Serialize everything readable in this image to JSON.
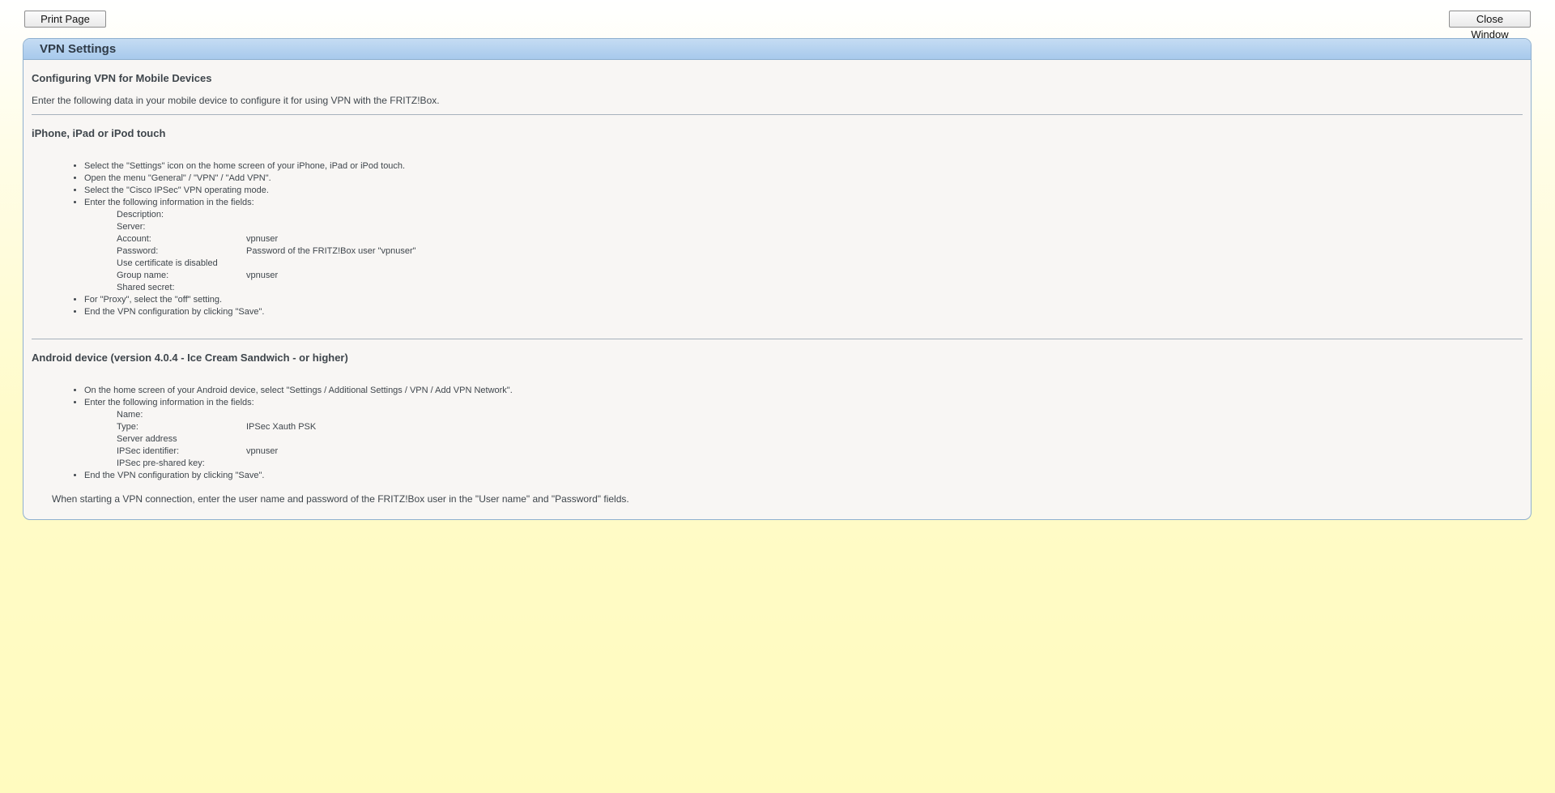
{
  "toolbar": {
    "print_label": "Print Page",
    "close_label": "Close Window"
  },
  "panel": {
    "header": "VPN Settings",
    "title": "Configuring VPN for Mobile Devices",
    "intro": "Enter the following data in your mobile device to configure it for using VPN with the FRITZ!Box.",
    "iphone": {
      "title": "iPhone, iPad or iPod touch",
      "steps": [
        "Select the \"Settings\" icon on the home screen of your iPhone, iPad or iPod touch.",
        "Open the menu \"General\" / \"VPN\" / \"Add VPN\".",
        "Select the \"Cisco IPSec\" VPN operating mode.",
        "Enter the following information in the fields:"
      ],
      "fields": [
        {
          "label": "Description:",
          "value": ""
        },
        {
          "label": "Server:",
          "value": ""
        },
        {
          "label": "Account:",
          "value": "vpnuser"
        },
        {
          "label": "Password:",
          "value": "Password of the FRITZ!Box user \"vpnuser\""
        },
        {
          "label": "Use certificate is disabled",
          "value": ""
        },
        {
          "label": "Group name:",
          "value": "vpnuser"
        },
        {
          "label": "Shared secret:",
          "value": ""
        }
      ],
      "after_steps": [
        "For \"Proxy\", select the \"off\" setting.",
        "End the VPN configuration by clicking \"Save\"."
      ]
    },
    "android": {
      "title": "Android device (version 4.0.4 - Ice Cream Sandwich - or higher)",
      "steps": [
        "On the home screen of your Android device, select \"Settings / Additional Settings / VPN / Add VPN Network\".",
        "Enter the following information in the fields:"
      ],
      "fields": [
        {
          "label": "Name:",
          "value": ""
        },
        {
          "label": "Type:",
          "value": "IPSec Xauth PSK"
        },
        {
          "label": "Server address",
          "value": ""
        },
        {
          "label": "IPSec identifier:",
          "value": "vpnuser"
        },
        {
          "label": "IPSec pre-shared key:",
          "value": ""
        }
      ],
      "after_steps": [
        "End the VPN configuration by clicking \"Save\"."
      ]
    },
    "outro": "When starting a VPN connection, enter the user name and password of the FRITZ!Box user in the \"User name\" and \"Password\" fields."
  }
}
